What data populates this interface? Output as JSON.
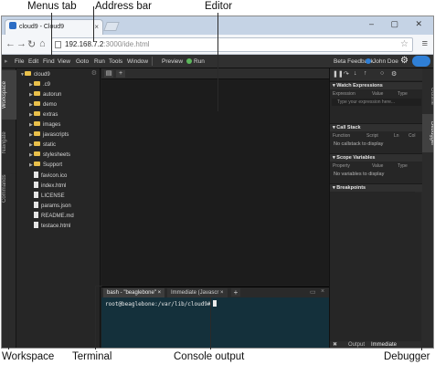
{
  "callouts": {
    "menus_tab": "Menus tab",
    "address_bar": "Address bar",
    "editor": "Editor",
    "workspace": "Workspace",
    "terminal": "Terminal",
    "console_output": "Console output",
    "debugger": "Debugger"
  },
  "browser": {
    "tab_title": "cloud9 - Cloud9",
    "tab_close": "×",
    "address_host": "192.168.7.2",
    "address_port": ":3000",
    "address_path": "/ide.html"
  },
  "menubar": {
    "items": [
      "File",
      "Edit",
      "Find",
      "View",
      "Goto",
      "Run",
      "Tools",
      "Window"
    ],
    "preview": "Preview",
    "run": "Run",
    "beta_feedback": "Beta Feedback",
    "user": "John Doe"
  },
  "left_tabs": [
    "Workspace",
    "Navigate",
    "Commands"
  ],
  "right_tabs": [
    "Outline",
    "Debugger"
  ],
  "workspace_tree": {
    "root": "cloud9",
    "folders": [
      ".c9",
      "autorun",
      "demo",
      "extras",
      "images",
      "javascripts",
      "static",
      "stylesheets",
      "Support"
    ],
    "files": [
      "favicon.ico",
      "index.html",
      "LICENSE",
      "params.json",
      "README.md",
      "testace.html"
    ]
  },
  "terminal": {
    "tab_bash": "bash - \"beaglebone\"",
    "tab_immediate": "Immediate (Javascr",
    "add": "+",
    "prompt": "root@beaglebone:/var/lib/cloud9#"
  },
  "debugger": {
    "watch_title": "Watch Expressions",
    "watch_cols": [
      "Expression",
      "Value",
      "Type"
    ],
    "watch_placeholder": "Type your expression here...",
    "callstack_title": "Call Stack",
    "callstack_cols": [
      "Function",
      "Script",
      "Ln",
      "Col"
    ],
    "callstack_note": "No callstack to display",
    "scope_title": "Scope Variables",
    "scope_cols": [
      "Property",
      "Value",
      "Type"
    ],
    "scope_note": "No variables to display",
    "breakpoints_title": "Breakpoints",
    "footer_output": "Output",
    "footer_immediate": "Immediate"
  }
}
